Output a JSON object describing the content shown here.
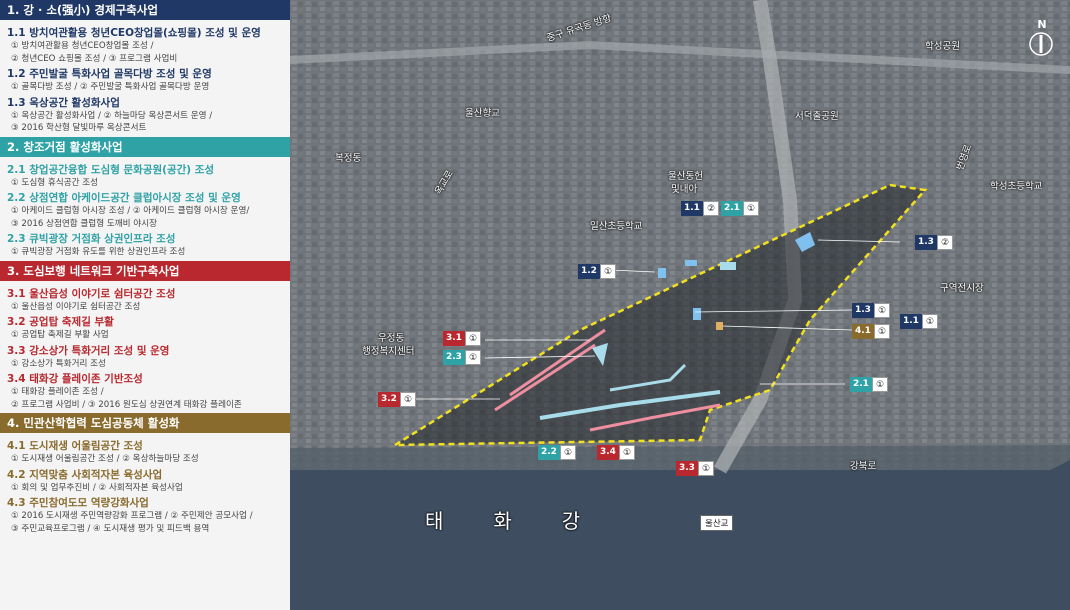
{
  "colors": {
    "sec1": "#1f3866",
    "sec2": "#2fa2a6",
    "sec3": "#b8282e",
    "sec4": "#8a6b2e",
    "river": "#3e4e60",
    "boundary": "#f0e020",
    "pink_route": "#ee8fa0",
    "blue_route": "#a8dcea"
  },
  "sections": [
    {
      "key": "sec1",
      "title": "1. 강 · 소(强小) 경제구축사업",
      "items": [
        {
          "title": "1.1  방치여관활용 청년CEO창업몰(쇼핑몰) 조성 및 운영",
          "lines": [
            "① 방치여관활용 청년CEO창업몰 조성 /",
            "② 청년CEO 쇼핑몰 조성 / ③ 프로그램 사업비"
          ]
        },
        {
          "title": "1.2  주민발굴 특화사업 골목다방 조성 및 운영",
          "lines": [
            "① 골목다방 조성 / ② 주민발굴 특화사업 골목다방 운영"
          ]
        },
        {
          "title": "1.3  옥상공간 활성화사업",
          "lines": [
            "① 옥상공간 활성화사업 / ② 하늘마당 옥상콘서트 운영 /",
            "③ 2016 학산형 달빛마루 옥상콘서트"
          ]
        }
      ]
    },
    {
      "key": "sec2",
      "title": "2. 창조거점 활성화사업",
      "items": [
        {
          "title": "2.1 창업공간융합 도심형 문화공원(공간) 조성",
          "lines": [
            "① 도심형 휴식공간 조성"
          ]
        },
        {
          "title": "2.2 상점연합 아케이드공간 클럽아시장 조성 및 운영",
          "lines": [
            "① 아케이드 클럽형 아시장 조성 / ② 아케이드 클럽형 아시장 운영/",
            "③ 2016 상점연합 클럽형 도깨비 야시장"
          ]
        },
        {
          "title": "2.3 큐빅광장 거점화 상권인프라 조성",
          "lines": [
            "① 큐빅광장 거점화 유도를 위한 상권인프라 조성"
          ]
        }
      ]
    },
    {
      "key": "sec3",
      "title": "3. 도심보행 네트워크 기반구축사업",
      "items": [
        {
          "title": "3.1 울산읍성 이야기로 쉼터공간 조성",
          "lines": [
            "① 울산읍성 이야기로 쉼터공간 조성"
          ]
        },
        {
          "title": "3.2 공업탑 축제길  부활",
          "lines": [
            "① 공업탑 축제길 부활 사업"
          ]
        },
        {
          "title": "3.3 강소상가 특화거리 조성 및 운영",
          "lines": [
            "① 강소상가 특화거리 조성"
          ]
        },
        {
          "title": "3.4 태화강 플레이존 기반조성",
          "lines": [
            "① 태화강 플레이존 조성 /",
            "② 프로그램 사업비 / ③ 2016 원도심 상권연계 태화강 플레이존"
          ]
        }
      ]
    },
    {
      "key": "sec4",
      "title": "4. 민관산학협력 도심공동체 활성화",
      "items": [
        {
          "title": "4.1 도시재생 어울림공간 조성",
          "lines": [
            "① 도시재생 어울림공간 조성 / ② 옥상하늘마당 조성"
          ]
        },
        {
          "title": "4.2 지역맞춤 사회적자본 육성사업",
          "lines": [
            "① 회의 및 업무추진비 / ② 사회적자본 육성사업"
          ]
        },
        {
          "title": "4.3 주민참여도모 역량강화사업",
          "lines": [
            "① 2016 도시재생 주민역량강화 프로그램 / ② 주민제안 공모사업 /",
            "③ 주민교육프로그램 / ④ 도시재생 평가 및 피드백 용역"
          ]
        }
      ]
    }
  ],
  "tags": [
    {
      "num": "1.1",
      "sub": "②",
      "color": "sec1"
    },
    {
      "num": "2.1",
      "sub": "①",
      "color": "sec2"
    },
    {
      "num": "1.3",
      "sub": "②",
      "color": "sec1"
    },
    {
      "num": "1.2",
      "sub": "①",
      "color": "sec1"
    },
    {
      "num": "1.3",
      "sub": "①",
      "color": "sec1"
    },
    {
      "num": "1.1",
      "sub": "①",
      "color": "sec1"
    },
    {
      "num": "4.1",
      "sub": "①",
      "color": "sec4"
    },
    {
      "num": "3.1",
      "sub": "①",
      "color": "sec3"
    },
    {
      "num": "2.3",
      "sub": "①",
      "color": "sec2"
    },
    {
      "num": "2.1",
      "sub": "①",
      "color": "sec2"
    },
    {
      "num": "3.2",
      "sub": "①",
      "color": "sec3"
    },
    {
      "num": "2.2",
      "sub": "①",
      "color": "sec2"
    },
    {
      "num": "3.4",
      "sub": "①",
      "color": "sec3"
    },
    {
      "num": "3.3",
      "sub": "①",
      "color": "sec3"
    }
  ],
  "map_labels": {
    "direction": "중구 유곡동 방향",
    "hakseong_park": "학성공원",
    "ulsan_school": "울산향교",
    "seodeok_park": "서덕출공원",
    "ulsan_dongheon": "울산동헌",
    "dongheon_2": "및내아",
    "ilsan_school": "일산초등학교",
    "hakseong_school": "학성초등학교",
    "bokjeong": "복정동",
    "okgyo_ro": "옥교로",
    "guyeok_market": "구역전시장",
    "ujeong": "우정동",
    "ujeong_center": "행정복지센터",
    "gangbuk_ro": "강북로",
    "river": "태화강",
    "bridge": "울산교",
    "compass": "N",
    "bunyeong": "번영로"
  }
}
